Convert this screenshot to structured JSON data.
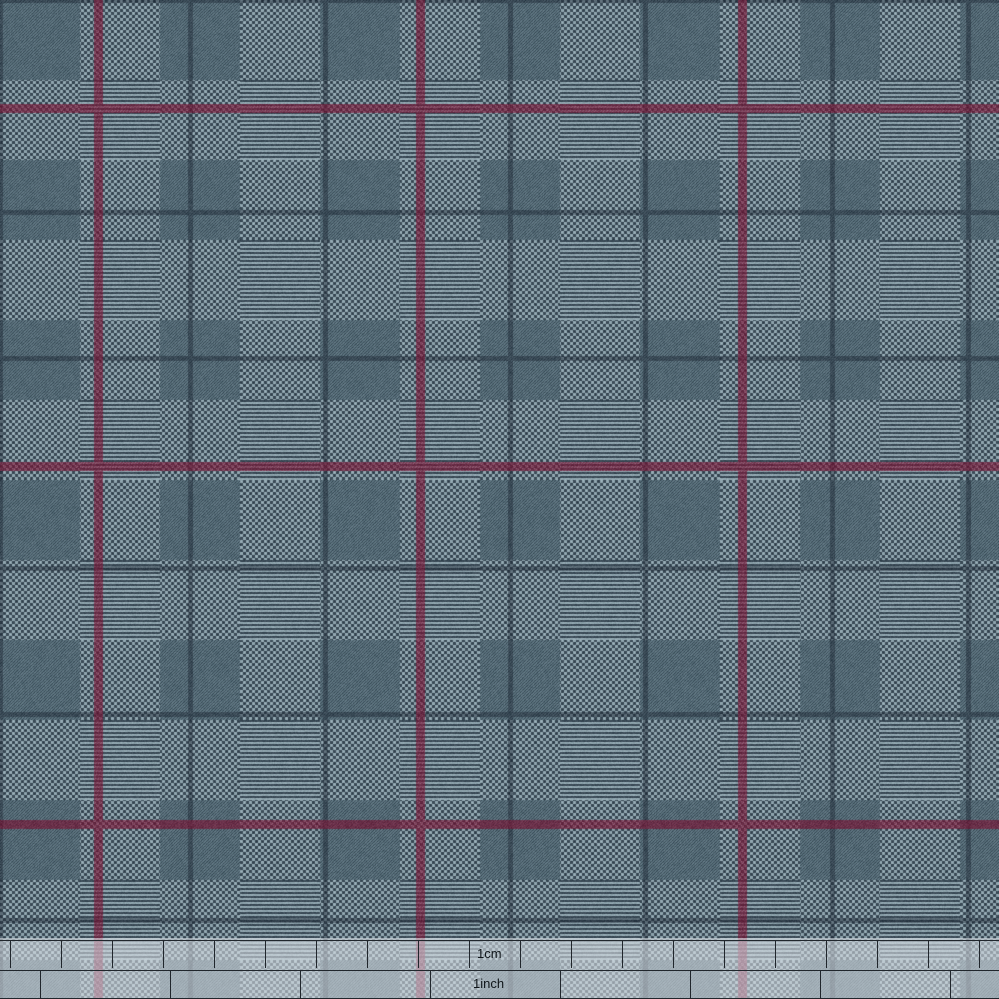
{
  "image": {
    "subject": "glen-check-plaid-wool-fabric-swatch",
    "colors": {
      "ground": "#5f7782",
      "light_yarn": "#b7cbd3",
      "dark_yarn": "#1c2633",
      "overcheck": "#7a1a3a",
      "ruler_background": "#e1e8ec",
      "ruler_lines": "#20262c"
    }
  },
  "ruler": {
    "cm_label": "1cm",
    "inch_label": "1inch"
  }
}
